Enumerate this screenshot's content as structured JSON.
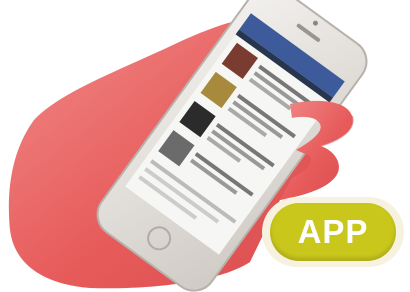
{
  "badge": {
    "label": "APP"
  },
  "colors": {
    "hand": "#e85a5a",
    "phone_frame": "#e6e4e0",
    "badge_fill": "#c9c71c",
    "screen_header": "#3d5a9a"
  },
  "icons": [
    "hand-illustration",
    "smartphone-illustration",
    "home-button-icon"
  ]
}
